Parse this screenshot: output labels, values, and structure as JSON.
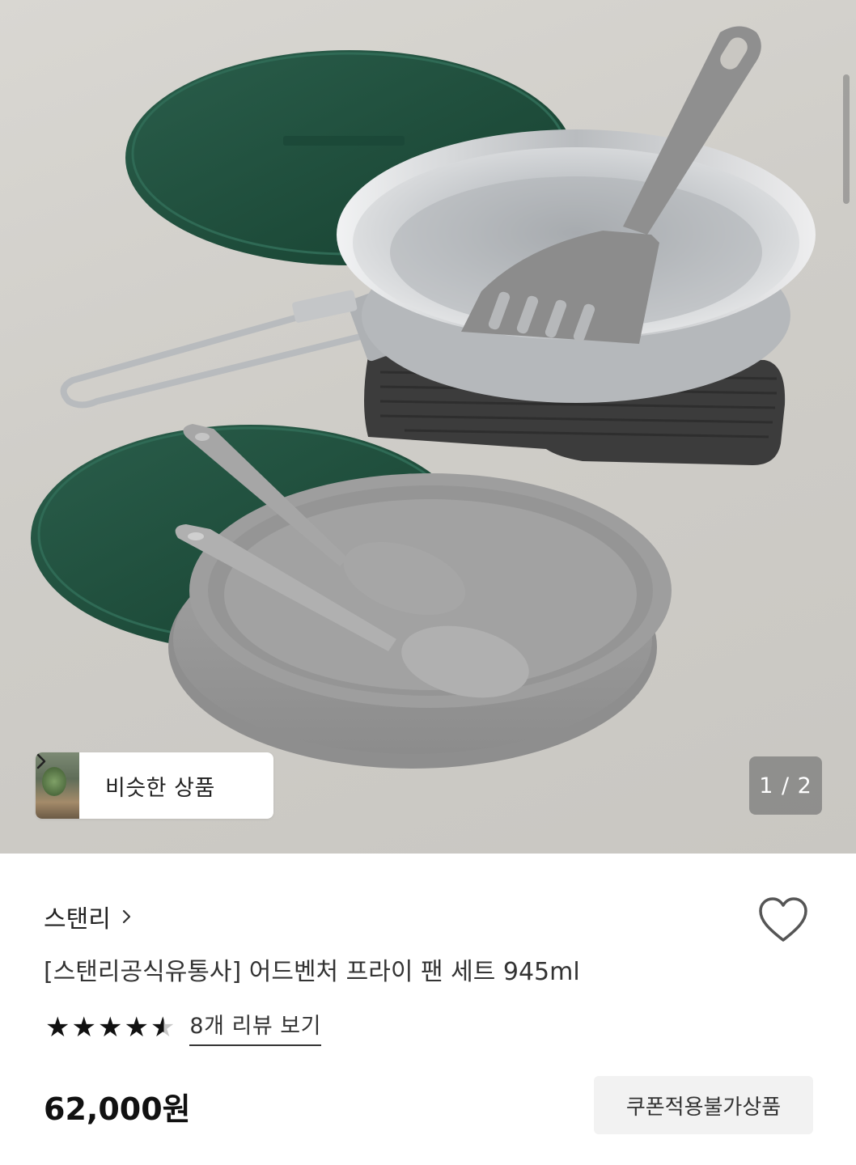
{
  "gallery": {
    "similar_label": "비슷한 상품",
    "counter": "1 / 2"
  },
  "product": {
    "brand": "스탠리",
    "title": "[스탠리공식유통사] 어드벤처 프라이 팬 세트 945ml",
    "rating": 4.5,
    "review_link": "8개 리뷰 보기",
    "price": "62,000원",
    "coupon_badge": "쿠폰적용불가상품"
  },
  "colors": {
    "lid_green": "#1f4f3f",
    "steel": "#c9cbcd",
    "gray_plate": "#9a9a9a",
    "mat": "#3f3f3f",
    "text": "#222222"
  },
  "icons": [
    "chevron-right-icon",
    "heart-icon",
    "star-icon"
  ]
}
